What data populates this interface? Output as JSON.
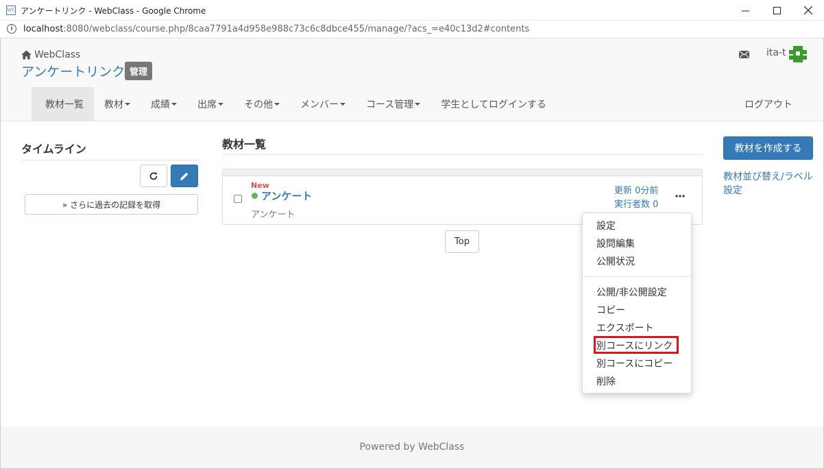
{
  "window": {
    "title": "アンケートリンク - WebClass - Google Chrome",
    "favicon": "WC",
    "minimize_icon": "minimize-icon",
    "maximize_icon": "maximize-icon",
    "close_icon": "close-icon"
  },
  "address": {
    "host": "localhost",
    "rest": ":8080/webclass/course.php/8caa7791a4d958e988c73c6c8dbce455/manage/?acs_=e40c13d2#contents"
  },
  "header": {
    "home_label": "WebClass",
    "course_title": "アンケートリンク",
    "admin_badge": "管理",
    "username": "ita-t",
    "avatar_color": "#3c9a2e"
  },
  "nav": {
    "items": [
      {
        "label": "教材一覧",
        "caret": false
      },
      {
        "label": "教材",
        "caret": true
      },
      {
        "label": "成績",
        "caret": true
      },
      {
        "label": "出席",
        "caret": true
      },
      {
        "label": "その他",
        "caret": true
      },
      {
        "label": "メンバー",
        "caret": true
      },
      {
        "label": "コース管理",
        "caret": true
      },
      {
        "label": "学生としてログインする",
        "caret": false
      }
    ],
    "logout": "ログアウト"
  },
  "timeline": {
    "title": "タイムライン",
    "more_button": "» さらに過去の記録を取得"
  },
  "main": {
    "title": "教材一覧",
    "item": {
      "new_label": "New",
      "title": "アンケート",
      "subtitle": "アンケート",
      "updated": "更新 0分前",
      "runs": "実行者数 0"
    },
    "top_button": "Top"
  },
  "dropdown": {
    "group1": [
      "設定",
      "設問編集",
      "公開状況"
    ],
    "group2": [
      "公開/非公開設定",
      "コピー",
      "エクスポート",
      "別コースにリンク",
      "別コースにコピー",
      "削除"
    ],
    "highlighted": "別コースにリンク"
  },
  "side": {
    "create_button": "教材を作成する",
    "sort_link": "教材並び替え/ラベル設定"
  },
  "footer": {
    "text": "Powered by WebClass"
  },
  "colors": {
    "accent": "#337ab7",
    "highlight": "#e0141c",
    "new": "#d9534f",
    "status_dot": "#5cb85c"
  }
}
